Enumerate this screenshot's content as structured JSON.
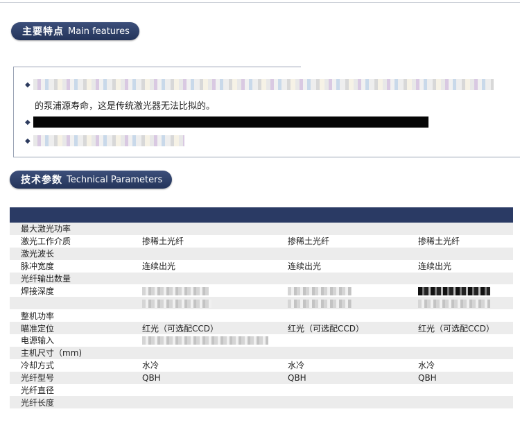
{
  "sections": {
    "main_features": {
      "zh": "主要特点",
      "en": "Main features"
    },
    "technical_parameters": {
      "zh": "技术参数",
      "en": "Technical Parameters"
    }
  },
  "features": {
    "continuation_text": "的泵浦源寿命，这是传统激光器无法比拟的。"
  },
  "spec_table": {
    "rows": [
      {
        "label": "最大激光功率",
        "values": [
          "",
          "",
          ""
        ]
      },
      {
        "label": "激光工作介质",
        "values": [
          "掺稀土光纤",
          "掺稀土光纤",
          "掺稀土光纤"
        ]
      },
      {
        "label": "激光波长",
        "values": [
          "",
          "",
          ""
        ]
      },
      {
        "label": "脉冲宽度",
        "values": [
          "连续出光",
          "连续出光",
          "连续出光"
        ]
      },
      {
        "label": "光纤输出数量",
        "values": [
          "",
          "",
          ""
        ]
      },
      {
        "label": "焊接深度",
        "values": [
          "",
          "",
          ""
        ]
      },
      {
        "label": "",
        "values": [
          "",
          "",
          ""
        ]
      },
      {
        "label": "整机功率",
        "values": [
          "",
          "",
          ""
        ]
      },
      {
        "label": "瞄准定位",
        "values": [
          "红光（可选配CCD）",
          "红光（可选配CCD）",
          "红光（可选配CCD）"
        ]
      },
      {
        "label": "电源输入",
        "values": [
          "",
          "",
          ""
        ]
      },
      {
        "label": "主机尺寸（mm)",
        "values": [
          "",
          "",
          ""
        ]
      },
      {
        "label": "冷却方式",
        "values": [
          "水冷",
          "水冷",
          "水冷"
        ]
      },
      {
        "label": "光纤型号",
        "values": [
          "QBH",
          "QBH",
          "QBH"
        ]
      },
      {
        "label": "光纤直径",
        "values": [
          "",
          "",
          ""
        ]
      },
      {
        "label": "光纤长度",
        "values": [
          "",
          "",
          ""
        ]
      }
    ]
  }
}
